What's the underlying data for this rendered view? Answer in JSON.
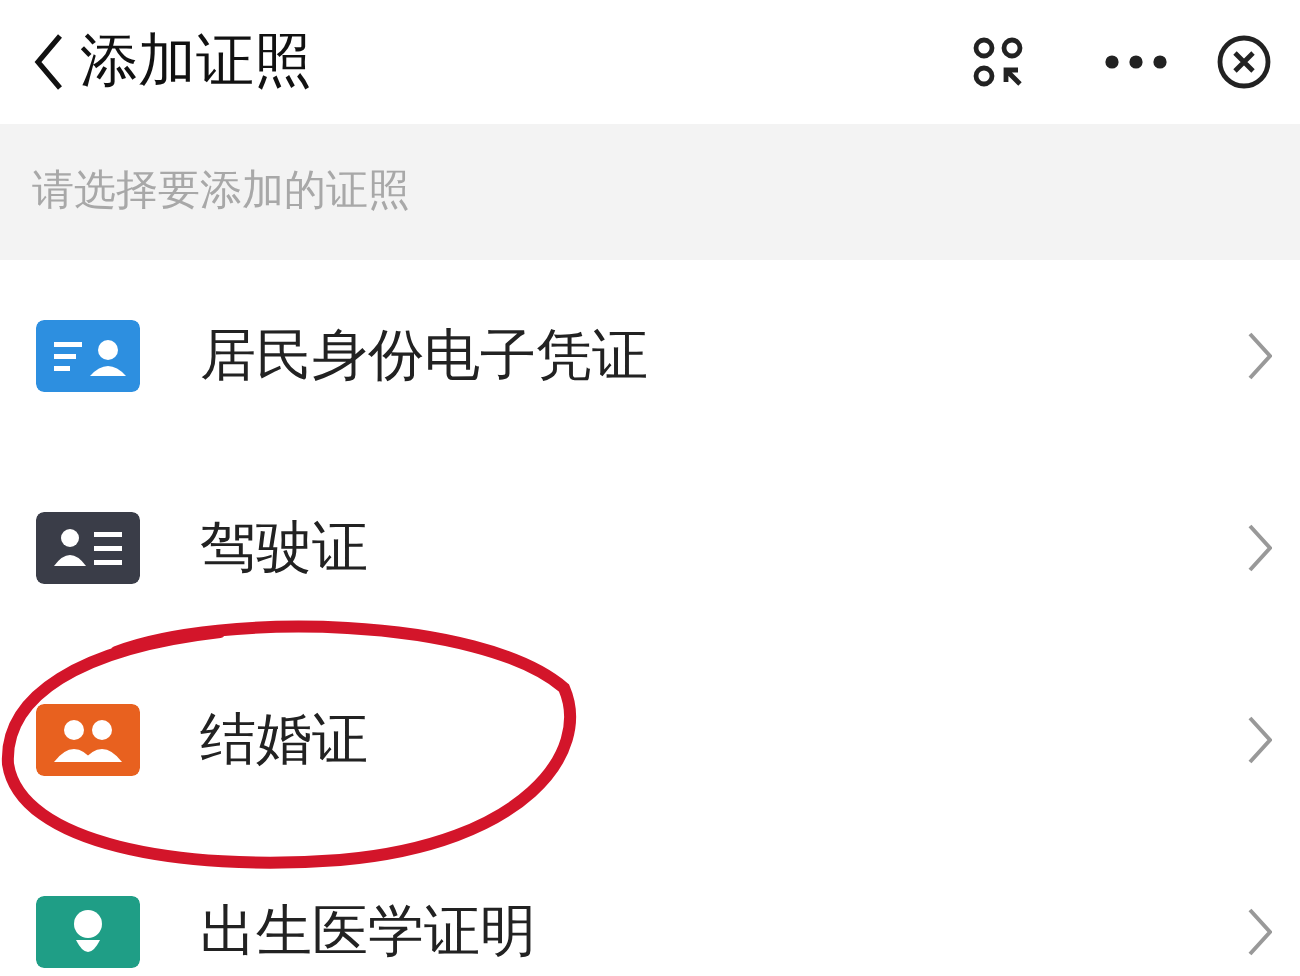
{
  "header": {
    "title": "添加证照"
  },
  "hint": "请选择要添加的证照",
  "items": [
    {
      "label": "居民身份电子凭证",
      "kind": "id-card",
      "color": "#2d8fe0",
      "circled": false
    },
    {
      "label": "驾驶证",
      "kind": "license",
      "color": "#3a3d48",
      "circled": false
    },
    {
      "label": "结婚证",
      "kind": "couple",
      "color": "#e8611f",
      "circled": true
    },
    {
      "label": "出生医学证明",
      "kind": "baby",
      "color": "#1f9e86",
      "circled": false
    }
  ]
}
